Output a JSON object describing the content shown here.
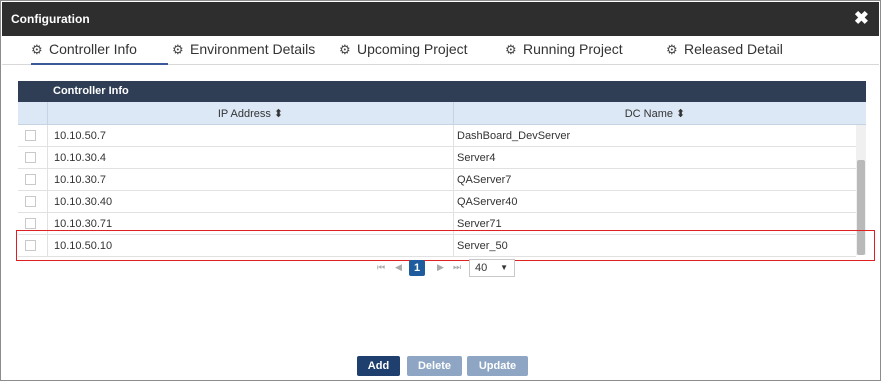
{
  "dialog": {
    "title": "Configuration",
    "close_glyph": "✖"
  },
  "tabs": [
    {
      "label": "Controller Info",
      "icon": "gear-icon",
      "active": true
    },
    {
      "label": "Environment Details",
      "icon": "gear-icon"
    },
    {
      "label": "Upcoming Project",
      "icon": "gear-icon"
    },
    {
      "label": "Running Project",
      "icon": "gear-icon"
    },
    {
      "label": "Released Detail",
      "icon": "gear-icon"
    }
  ],
  "grid": {
    "title": "Controller Info",
    "columns": [
      "IP Address ⬍",
      "DC Name ⬍"
    ],
    "rows": [
      {
        "ip": "10.10.50.7",
        "dc": "DashBoard_DevServer"
      },
      {
        "ip": "10.10.30.4",
        "dc": "Server4"
      },
      {
        "ip": "10.10.30.7",
        "dc": "QAServer7"
      },
      {
        "ip": "10.10.30.40",
        "dc": "QAServer40"
      },
      {
        "ip": "10.10.30.71",
        "dc": "Server71"
      },
      {
        "ip": "10.10.50.10",
        "dc": "Server_50"
      }
    ]
  },
  "pager": {
    "first": "⏮",
    "prev": "◀",
    "current_page": "1",
    "next": "▶",
    "last": "⏭",
    "page_size": "40",
    "dropdown": "▼"
  },
  "buttons": {
    "add": "Add",
    "delete": "Delete",
    "update": "Update"
  },
  "colors": {
    "titlebar": "#2e2e2e",
    "grid_header": "#2f3e55",
    "primary_button": "#1f3f6e",
    "highlight": "#e02020"
  }
}
